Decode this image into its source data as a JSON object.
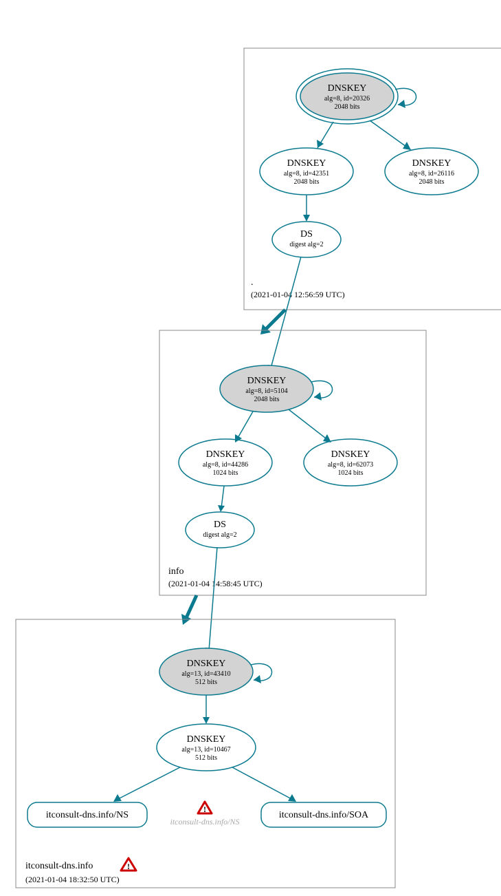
{
  "zones": {
    "root": {
      "label": ".",
      "timestamp": "(2021-01-04 12:56:59 UTC)"
    },
    "info": {
      "label": "info",
      "timestamp": "(2021-01-04 14:58:45 UTC)"
    },
    "domain": {
      "label": "itconsult-dns.info",
      "timestamp": "(2021-01-04 18:32:50 UTC)"
    }
  },
  "nodes": {
    "root_ksk": {
      "title": "DNSKEY",
      "line1": "alg=8, id=20326",
      "line2": "2048 bits"
    },
    "root_zsk1": {
      "title": "DNSKEY",
      "line1": "alg=8, id=42351",
      "line2": "2048 bits"
    },
    "root_zsk2": {
      "title": "DNSKEY",
      "line1": "alg=8, id=26116",
      "line2": "2048 bits"
    },
    "root_ds": {
      "title": "DS",
      "line1": "digest alg=2"
    },
    "info_ksk": {
      "title": "DNSKEY",
      "line1": "alg=8, id=5104",
      "line2": "2048 bits"
    },
    "info_zsk1": {
      "title": "DNSKEY",
      "line1": "alg=8, id=44286",
      "line2": "1024 bits"
    },
    "info_zsk2": {
      "title": "DNSKEY",
      "line1": "alg=8, id=62073",
      "line2": "1024 bits"
    },
    "info_ds": {
      "title": "DS",
      "line1": "digest alg=2"
    },
    "dom_ksk": {
      "title": "DNSKEY",
      "line1": "alg=13, id=43410",
      "line2": "512 bits"
    },
    "dom_zsk": {
      "title": "DNSKEY",
      "line1": "alg=13, id=10467",
      "line2": "512 bits"
    },
    "dom_ns": {
      "title": "itconsult-dns.info/NS"
    },
    "dom_ns_grey": {
      "title": "itconsult-dns.info/NS"
    },
    "dom_soa": {
      "title": "itconsult-dns.info/SOA"
    }
  }
}
